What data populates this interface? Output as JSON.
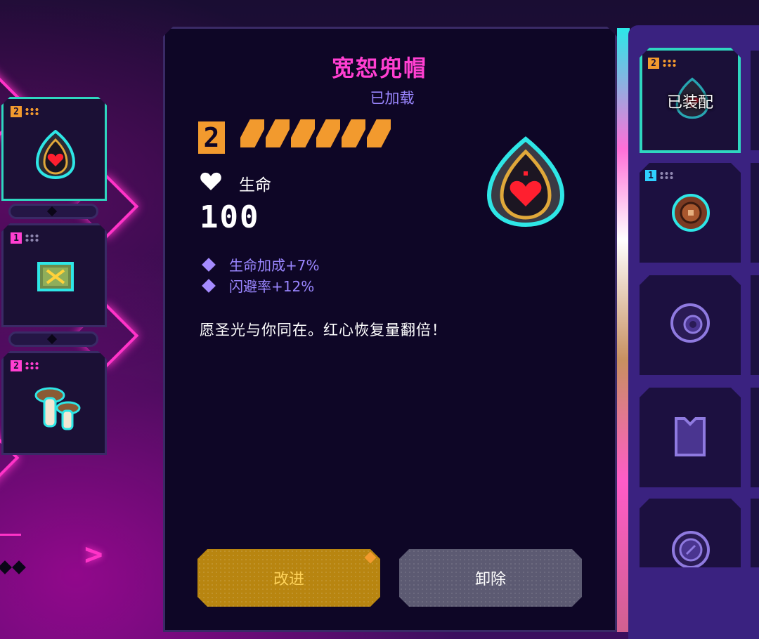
{
  "item": {
    "name": "宽恕兜帽",
    "status": "已加载",
    "tier": "2",
    "star_count": 6,
    "stat_label": "生命",
    "stat_value": "100",
    "bonuses": [
      "生命加成+7%",
      "闪避率+12%"
    ],
    "description": "愿圣光与你同在。红心恢复量翻倍！"
  },
  "buttons": {
    "upgrade_label": "改进",
    "unequip_label": "卸除"
  },
  "left_slots": [
    {
      "tier": "2",
      "icon": "heart-hood-icon",
      "selected": true
    },
    {
      "tier": "1",
      "icon": "map-scroll-icon",
      "selected": false
    },
    {
      "tier": "2",
      "icon": "mushroom-icon",
      "selected": false
    }
  ],
  "inventory": {
    "equipped_label": "已装配",
    "slots": [
      {
        "tier": "2",
        "icon": "heart-hood-icon",
        "equipped": true
      },
      {
        "tier": "1",
        "icon": "shield-icon",
        "equipped": false
      },
      {
        "tier": "",
        "icon": "locked-orb-icon",
        "equipped": false
      },
      {
        "tier": "",
        "icon": "locked-armor-icon",
        "equipped": false
      },
      {
        "tier": "",
        "icon": "locked-coin-icon",
        "equipped": false
      }
    ]
  },
  "colors": {
    "accent_magenta": "#ff3fd1",
    "tier_orange": "#f29a2e",
    "text_purple": "#9a86ff",
    "highlight_teal": "#2fd6c0"
  }
}
